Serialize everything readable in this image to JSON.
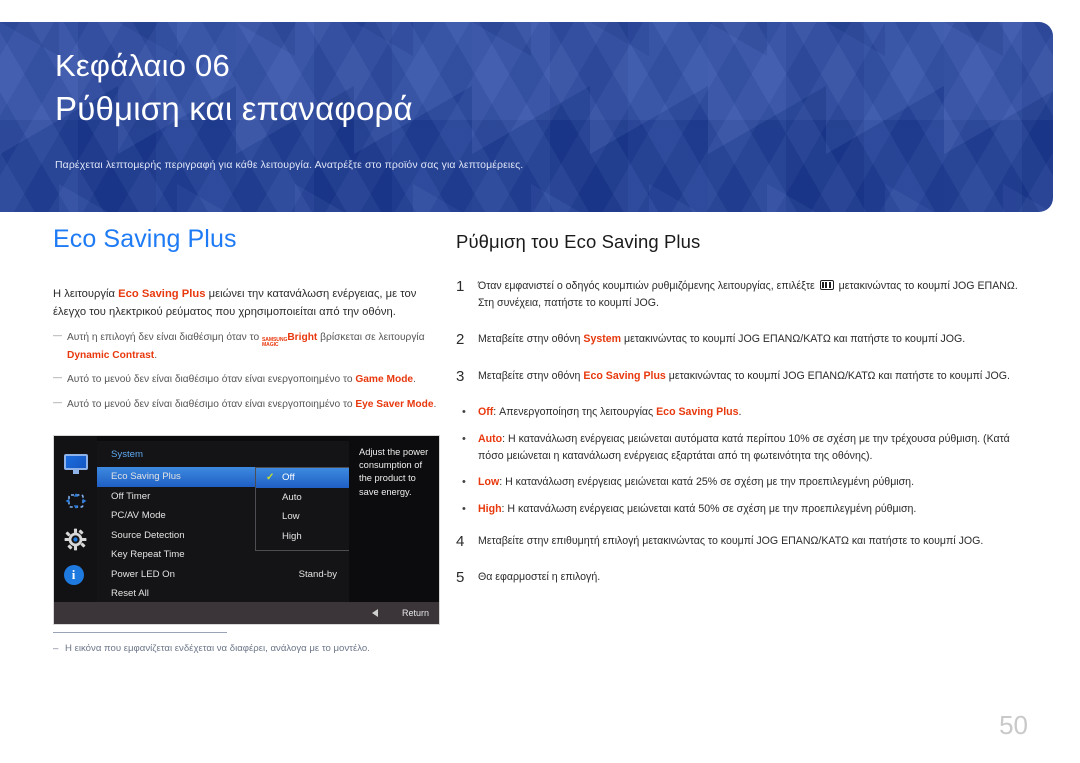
{
  "banner": {
    "chapter_label": "Κεφάλαιο 06",
    "chapter_title": "Ρύθμιση και επαναφορά",
    "subtitle": "Παρέχεται λεπτομερής περιγραφή για κάθε λειτουργία. Ανατρέξτε στο προϊόν σας για λεπτομέρειες.",
    "bg_color": "#1e3f9e"
  },
  "left": {
    "section_title": "Eco Saving Plus",
    "section_title_color": "#1e7bf5",
    "intro_a": "Η λειτουργία ",
    "intro_hl": "Eco Saving Plus",
    "intro_b": " μειώνει την κατανάλωση ενέργειας, με τον έλεγχο του ηλεκτρικού ρεύματος που χρησιμοποιείται από την οθόνη.",
    "notes": [
      {
        "a": "Αυτή η επιλογή δεν είναι διαθέσιμη όταν το ",
        "magic_top": "SAMSUNG",
        "magic_bottom": "MAGIC",
        "magic_word": "Bright",
        "b": " βρίσκεται σε λειτουργία ",
        "hl": "Dynamic Contrast",
        "c": "."
      },
      {
        "a": "Αυτό το μενού δεν είναι διαθέσιμο όταν είναι ενεργοποιημένο το ",
        "hl": "Game Mode",
        "c": "."
      },
      {
        "a": "Αυτό το μενού δεν είναι διαθέσιμο όταν είναι ενεργοποιημένο το ",
        "hl": "Eye Saver Mode",
        "c": "."
      }
    ],
    "footnote": "Η εικόνα που εμφανίζεται ενδέχεται να διαφέρει, ανάλογα με το μοντέλο."
  },
  "osd": {
    "icons": [
      "monitor-icon",
      "navigation-icon",
      "gear-icon",
      "info-icon"
    ],
    "panel_title": "System",
    "menu_items": [
      {
        "label": "Eco Saving Plus",
        "value": "",
        "active": true
      },
      {
        "label": "Off Timer",
        "value": "",
        "active": false
      },
      {
        "label": "PC/AV Mode",
        "value": "",
        "active": false
      },
      {
        "label": "Source Detection",
        "value": "",
        "active": false
      },
      {
        "label": "Key Repeat Time",
        "value": "",
        "active": false
      },
      {
        "label": "Power LED On",
        "value": "Stand-by",
        "active": false
      },
      {
        "label": "Reset All",
        "value": "",
        "active": false
      }
    ],
    "submenu": [
      {
        "label": "Off",
        "selected": true
      },
      {
        "label": "Auto",
        "selected": false
      },
      {
        "label": "Low",
        "selected": false
      },
      {
        "label": "High",
        "selected": false
      }
    ],
    "check_glyph": "✓",
    "help_text": "Adjust the power consumption of the product to save energy.",
    "return_label": "Return",
    "highlight_color": "#2f7bd6"
  },
  "right": {
    "heading": "Ρύθμιση του Eco Saving Plus",
    "steps": [
      {
        "num": "1",
        "pre": "Όταν εμφανιστεί ο οδηγός κουμπιών ρυθμιζόμενης λειτουργίας, επιλέξτε ",
        "icon": "jog-menu-icon",
        "post": " μετακινώντας το κουμπί JOG ΕΠΑΝΩ. Στη συνέχεια, πατήστε το κουμπί JOG."
      },
      {
        "num": "2",
        "pre": "Μεταβείτε στην οθόνη ",
        "hl": "System",
        "post": " μετακινώντας το κουμπί JOG ΕΠΑΝΩ/ΚΑΤΩ και πατήστε το κουμπί JOG."
      },
      {
        "num": "3",
        "pre": "Μεταβείτε στην οθόνη ",
        "hl": "Eco Saving Plus",
        "post": " μετακινώντας το κουμπί JOG ΕΠΑΝΩ/ΚΑΤΩ και πατήστε το κουμπί JOG."
      }
    ],
    "bullets": [
      {
        "term": "Off",
        "mid": ": Απενεργοποίηση της λειτουργίας ",
        "hl2": "Eco Saving Plus",
        "post": "."
      },
      {
        "term": "Auto",
        "mid": ": Η κατανάλωση ενέργειας μειώνεται αυτόματα κατά περίπου 10% σε σχέση με την τρέχουσα ρύθμιση. (Κατά πόσο μειώνεται η κατανάλωση ενέργειας εξαρτάται από τη φωτεινότητα της οθόνης).",
        "hl2": "",
        "post": ""
      },
      {
        "term": "Low",
        "mid": ": Η κατανάλωση ενέργειας μειώνεται κατά 25% σε σχέση με την προεπιλεγμένη ρύθμιση.",
        "hl2": "",
        "post": ""
      },
      {
        "term": "High",
        "mid": ": Η κατανάλωση ενέργειας μειώνεται κατά 50% σε σχέση με την προεπιλεγμένη ρύθμιση.",
        "hl2": "",
        "post": ""
      }
    ],
    "steps_tail": [
      {
        "num": "4",
        "pre": "Μεταβείτε στην επιθυμητή επιλογή μετακινώντας το κουμπί JOG ΕΠΑΝΩ/ΚΑΤΩ και πατήστε το κουμπί JOG.",
        "hl": "",
        "post": ""
      },
      {
        "num": "5",
        "pre": "Θα εφαρμοστεί η επιλογή.",
        "hl": "",
        "post": ""
      }
    ]
  },
  "page_number": "50"
}
